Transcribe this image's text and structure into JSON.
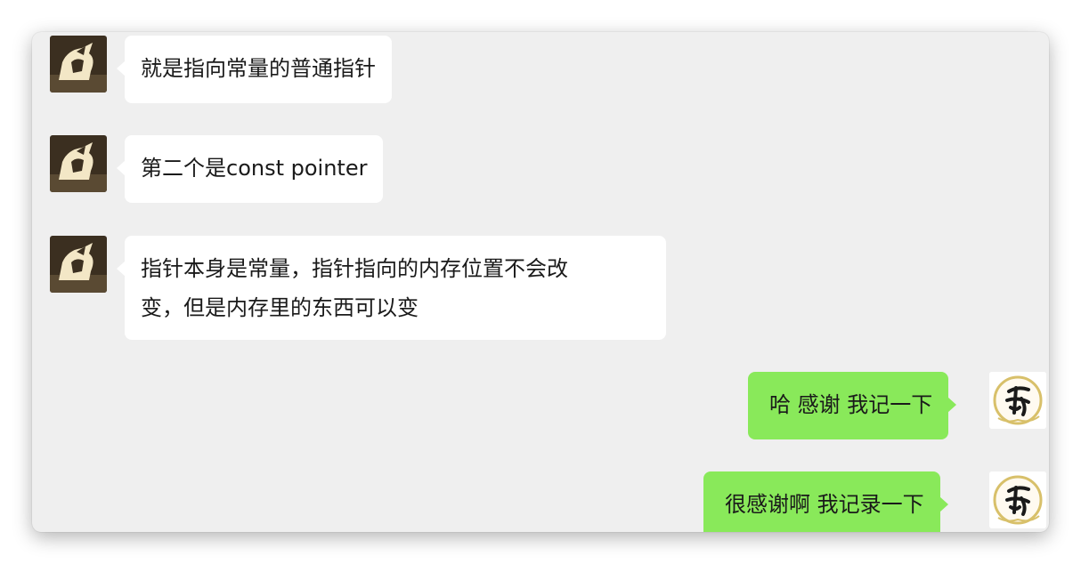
{
  "chat": {
    "messages": [
      {
        "sender": "other",
        "avatar": "cartoon-avatar",
        "text": "就是指向常量的普通指针"
      },
      {
        "sender": "other",
        "avatar": "cartoon-avatar",
        "text": "第二个是const pointer"
      },
      {
        "sender": "other",
        "avatar": "cartoon-avatar",
        "text_line1": "指针本身是常量，指针指向的内存位置不会改",
        "text_line2": "变，但是内存里的东西可以变"
      },
      {
        "sender": "self",
        "avatar": "calligraphy-avatar",
        "text": "哈 感谢 我记一下"
      },
      {
        "sender": "self",
        "avatar": "calligraphy-avatar",
        "text": "很感谢啊 我记录一下"
      }
    ]
  },
  "colors": {
    "window_bg": "#efefef",
    "incoming_bubble": "#ffffff",
    "outgoing_bubble": "#89e95a"
  }
}
